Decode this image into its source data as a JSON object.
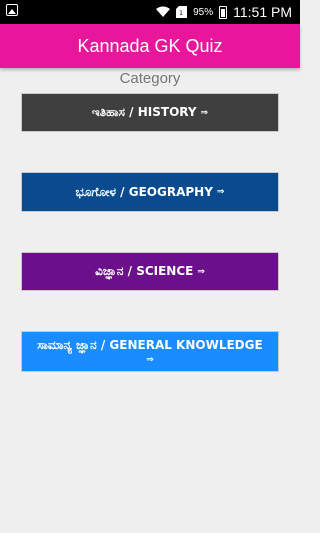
{
  "status_bar": {
    "battery_percent": "95%",
    "time": "11:51 PM",
    "icons": [
      "image-icon",
      "wifi-icon",
      "sim-icon",
      "battery-icon"
    ]
  },
  "app_bar": {
    "title": "Kannada GK Quiz",
    "color": "#e8169b"
  },
  "category_label": "Category",
  "categories": [
    {
      "label": "ಇತಿಹಾಸ / HISTORY",
      "arrow": "⇒",
      "color": "#3f3f3f"
    },
    {
      "label": "ಭೂಗೋಳ / GEOGRAPHY",
      "arrow": "⇒",
      "color": "#0a4a8e"
    },
    {
      "label": "ವಿಜ್ಞಾನ / SCIENCE",
      "arrow": "⇒",
      "color": "#6c0f8a"
    },
    {
      "label": "ಸಾಮಾನ್ಯ ಜ್ಞಾನ / GENERAL KNOWLEDGE",
      "arrow": "⇒",
      "color": "#1b8cff"
    }
  ]
}
